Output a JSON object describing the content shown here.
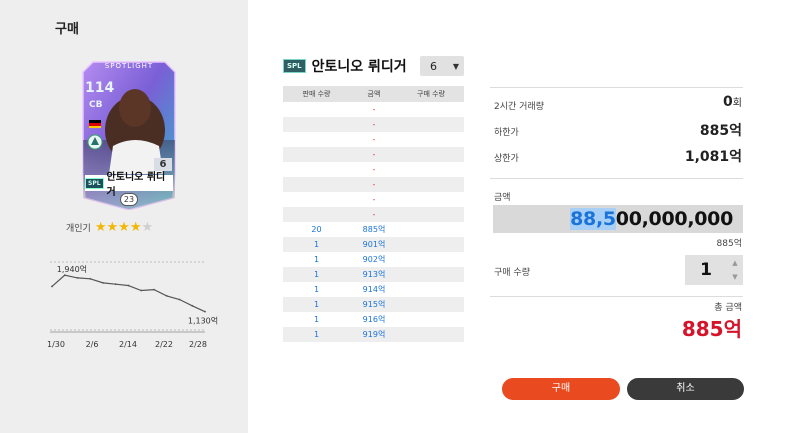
{
  "header": {
    "title": "구매"
  },
  "card": {
    "badge": "SPOTLIGHT",
    "rating": "114",
    "position": "CB",
    "level": "6",
    "season_tag": "SPL",
    "name": "안토니오 뤼디거",
    "year": "23"
  },
  "popularity": {
    "label": "개인기",
    "stars": 4,
    "max": 5,
    "on_color": "#f2b705",
    "off_color": "#cfcfcf"
  },
  "chart_data": {
    "type": "line",
    "x": [
      "1/30",
      "2/3",
      "2/6",
      "2/9",
      "2/12",
      "2/14",
      "2/17",
      "2/20",
      "2/22",
      "2/25",
      "2/27",
      "2/28",
      "3/1"
    ],
    "xticks": [
      "1/30",
      "2/6",
      "2/14",
      "2/22",
      "2/28"
    ],
    "values": [
      1690,
      1940,
      1880,
      1860,
      1770,
      1740,
      1710,
      1600,
      1620,
      1480,
      1400,
      1260,
      1130
    ],
    "max_label": "1,940억",
    "min_label": "1,130억",
    "ylim": [
      900,
      2100
    ]
  },
  "player": {
    "season_tag": "SPL",
    "name": "안토니오 뤼디거"
  },
  "level_select": {
    "value": "6",
    "arrow": "▼"
  },
  "orders": {
    "headers": [
      "판매 수량",
      "금액",
      "구매 수량"
    ],
    "rows": [
      {
        "qty": "",
        "price": "-",
        "buy": ""
      },
      {
        "qty": "",
        "price": "-",
        "buy": ""
      },
      {
        "qty": "",
        "price": "-",
        "buy": ""
      },
      {
        "qty": "",
        "price": "-",
        "buy": ""
      },
      {
        "qty": "",
        "price": "-",
        "buy": ""
      },
      {
        "qty": "",
        "price": "-",
        "buy": ""
      },
      {
        "qty": "",
        "price": "-",
        "buy": ""
      },
      {
        "qty": "",
        "price": "-",
        "buy": ""
      },
      {
        "qty": "20",
        "price": "885억",
        "buy": ""
      },
      {
        "qty": "1",
        "price": "901억",
        "buy": ""
      },
      {
        "qty": "1",
        "price": "902억",
        "buy": ""
      },
      {
        "qty": "1",
        "price": "913억",
        "buy": ""
      },
      {
        "qty": "1",
        "price": "914억",
        "buy": ""
      },
      {
        "qty": "1",
        "price": "915억",
        "buy": ""
      },
      {
        "qty": "1",
        "price": "916억",
        "buy": ""
      },
      {
        "qty": "1",
        "price": "919억",
        "buy": ""
      }
    ]
  },
  "stats": {
    "volume_label": "2시간 거래량",
    "volume_value": "0",
    "volume_unit": "회",
    "min_label": "하한가",
    "min_value": "885억",
    "max_label": "상한가",
    "max_value": "1,081억"
  },
  "amount": {
    "label": "금액",
    "selected_part": "88,5",
    "rest_part": "00,000,000",
    "sub": "885억"
  },
  "quantity": {
    "label": "구매 수량",
    "value": "1",
    "up": "▲",
    "down": "▼"
  },
  "total": {
    "label": "총 금액",
    "value": "885억"
  },
  "actions": {
    "buy_label": "구매",
    "cancel_label": "취소"
  }
}
